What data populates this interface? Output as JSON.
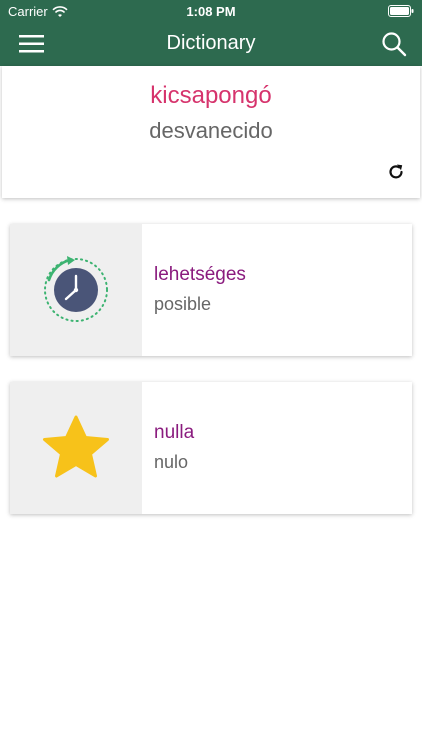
{
  "status_bar": {
    "carrier": "Carrier",
    "time": "1:08 PM"
  },
  "nav": {
    "title": "Dictionary"
  },
  "word_of_day": {
    "hungarian": "kicsapongó",
    "spanish": "desvanecido"
  },
  "cards": [
    {
      "icon": "history-clock-icon",
      "term": "lehetséges",
      "meaning": "posible"
    },
    {
      "icon": "star-icon",
      "term": "nulla",
      "meaning": "nulo"
    }
  ],
  "colors": {
    "header": "#2d6a4f",
    "hungarian_word": "#d6336c",
    "card_term": "#8a1b7e",
    "star": "#f7c21a",
    "clock": "#4a5578",
    "accent_green": "#3cb371"
  }
}
